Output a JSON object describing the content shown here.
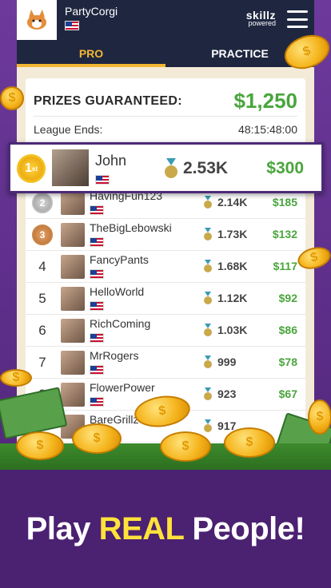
{
  "topbar": {
    "username": "PartyCorgi",
    "brand": "skillz",
    "brand_sub": "powered"
  },
  "tabs": [
    {
      "label": "PRO",
      "active": true
    },
    {
      "label": "PRACTICE",
      "active": false
    }
  ],
  "prizes": {
    "label": "PRIZES GUARANTEED:",
    "value": "$1,250"
  },
  "league": {
    "label": "League Ends:",
    "time": "48:15:48:00"
  },
  "highlight": {
    "rank": "1",
    "rank_suffix": "st",
    "name": "John",
    "score": "2.53K",
    "payout": "$300"
  },
  "leaderboard": [
    {
      "rank": "2",
      "name": "HavingFun123",
      "score": "2.14K",
      "payout": "$185",
      "medal": "silver"
    },
    {
      "rank": "3",
      "name": "TheBigLebowski",
      "score": "1.73K",
      "payout": "$132",
      "medal": "bronze"
    },
    {
      "rank": "4",
      "name": "FancyPants",
      "score": "1.68K",
      "payout": "$117"
    },
    {
      "rank": "5",
      "name": "HelloWorld",
      "score": "1.12K",
      "payout": "$92"
    },
    {
      "rank": "6",
      "name": "RichComing",
      "score": "1.03K",
      "payout": "$86"
    },
    {
      "rank": "7",
      "name": "MrRogers",
      "score": "999",
      "payout": "$78"
    },
    {
      "rank": "8",
      "name": "FlowerPower",
      "score": "923",
      "payout": "$67"
    },
    {
      "rank": "9",
      "name": "BareGrillz",
      "score": "917",
      "payout": ""
    }
  ],
  "tagline": {
    "pre": "Play ",
    "em": "REAL",
    "post": " People!"
  },
  "colors": {
    "accent": "#f2b632",
    "money": "#49a53c",
    "header": "#1f2740",
    "purple": "#5b2d86"
  }
}
